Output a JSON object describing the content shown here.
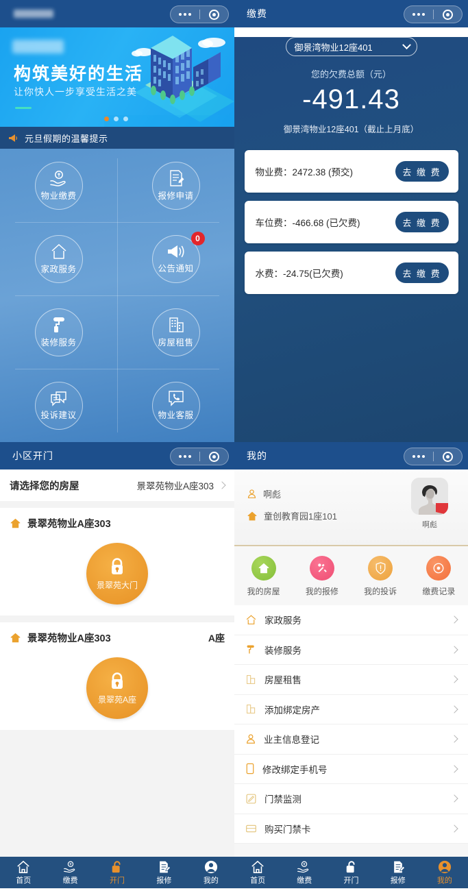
{
  "panel_home": {
    "titlebar": {
      "title": "",
      "title_blurred": true,
      "more_icon": "more-dots-icon",
      "capsule_icon": "target-icon"
    },
    "banner": {
      "badge_blurred": true,
      "headline": "构筑美好的生活",
      "subhead": "让你快人一步享受生活之美",
      "art_icon": "isometric-building-illustration",
      "dots_count": 3,
      "dot_active_index": 0,
      "dot_active_color": "#e8882c"
    },
    "notice": {
      "icon": "megaphone-icon",
      "text": "元旦假期的温馨提示"
    },
    "grid": [
      {
        "label": "物业缴费",
        "icon": "hand-coin-icon",
        "badge": null
      },
      {
        "label": "报修申请",
        "icon": "document-edit-icon",
        "badge": null
      },
      {
        "label": "家政服务",
        "icon": "home-icon",
        "badge": null
      },
      {
        "label": "公告通知",
        "icon": "speaker-icon",
        "badge": "0"
      },
      {
        "label": "装修服务",
        "icon": "paint-roller-icon",
        "badge": null
      },
      {
        "label": "房屋租售",
        "icon": "buildings-icon",
        "badge": null
      },
      {
        "label": "投诉建议",
        "icon": "chat-bubbles-icon",
        "badge": null
      },
      {
        "label": "物业客服",
        "icon": "phone-bubble-icon",
        "badge": null
      }
    ],
    "tabbar": [
      {
        "label": "首页",
        "icon": "home-icon",
        "active": true
      },
      {
        "label": "缴费",
        "icon": "hand-coin-icon",
        "active": false
      },
      {
        "label": "开门",
        "icon": "unlock-icon",
        "active": false
      },
      {
        "label": "报修",
        "icon": "document-edit-icon",
        "active": false
      },
      {
        "label": "我的",
        "icon": "user-icon",
        "active": false
      }
    ]
  },
  "panel_payment": {
    "titlebar": {
      "title": "缴费",
      "more_icon": "more-dots-icon",
      "capsule_icon": "target-icon"
    },
    "property_select": {
      "value": "御景湾物业12座401",
      "icon": "chevron-down-icon"
    },
    "owed_label": "您的欠费总额（元）",
    "owed_amount": "-491.43",
    "owed_sub": "御景湾物业12座401（截止上月底）",
    "fees": [
      {
        "text": "物业费：2472.38 (预交)",
        "button": "去 缴 费"
      },
      {
        "text": "车位费：-466.68 (已欠费)",
        "button": "去 缴 费"
      },
      {
        "text": "水费：-24.75(已欠费)",
        "button": "去 缴 费"
      }
    ],
    "tabbar": [
      {
        "label": "首页",
        "icon": "home-icon",
        "active": false
      },
      {
        "label": "缴费",
        "icon": "hand-coin-icon",
        "active": true
      },
      {
        "label": "开门",
        "icon": "unlock-icon",
        "active": false
      },
      {
        "label": "报修",
        "icon": "document-edit-icon",
        "active": false
      },
      {
        "label": "我的",
        "icon": "user-icon",
        "active": false
      }
    ]
  },
  "panel_door": {
    "titlebar": {
      "title": "小区开门",
      "more_icon": "more-dots-icon",
      "capsule_icon": "target-icon"
    },
    "select_row": {
      "label": "请选择您的房屋",
      "value": "景翠苑物业A座303",
      "icon": "chevron-right-icon"
    },
    "cards": [
      {
        "house_icon": "home-icon",
        "name": "景翠苑物业A座303",
        "right_tag": "",
        "button_label": "景翠苑大门",
        "button_icon": "lock-icon"
      },
      {
        "house_icon": "home-icon",
        "name": "景翠苑物业A座303",
        "right_tag": "A座",
        "button_label": "景翠苑A座",
        "button_icon": "lock-icon"
      }
    ],
    "tabbar": [
      {
        "label": "首页",
        "icon": "home-icon",
        "active": false
      },
      {
        "label": "缴费",
        "icon": "hand-coin-icon",
        "active": false
      },
      {
        "label": "开门",
        "icon": "unlock-icon",
        "active": true
      },
      {
        "label": "报修",
        "icon": "document-edit-icon",
        "active": false
      },
      {
        "label": "我的",
        "icon": "user-icon",
        "active": false
      }
    ]
  },
  "panel_mine": {
    "titlebar": {
      "title": "我的",
      "more_icon": "more-dots-icon",
      "capsule_icon": "target-icon"
    },
    "profile": {
      "user_icon": "user-outline-icon",
      "user_name": "啊彪",
      "home_icon": "home-icon",
      "address": "童创教育园1座101",
      "avatar_icon": "avatar-photo",
      "avatar_name": "啊彪"
    },
    "quick": [
      {
        "label": "我的房屋",
        "icon": "home-icon",
        "color": "#8cc63f"
      },
      {
        "label": "我的报修",
        "icon": "wrench-icon",
        "color": "#f0557a"
      },
      {
        "label": "我的投诉",
        "icon": "shield-icon",
        "color": "#f0a840"
      },
      {
        "label": "缴费记录",
        "icon": "coin-icon",
        "color": "#f4793f"
      }
    ],
    "menu": [
      {
        "label": "家政服务",
        "icon": "home-icon",
        "chevron": "chevron-right-icon"
      },
      {
        "label": "装修服务",
        "icon": "paint-roller-icon",
        "chevron": "chevron-right-icon"
      },
      {
        "label": "房屋租售",
        "icon": "buildings-icon",
        "chevron": "chevron-right-icon"
      },
      {
        "label": "添加绑定房产",
        "icon": "buildings-icon",
        "chevron": "chevron-right-icon"
      },
      {
        "label": "业主信息登记",
        "icon": "user-outline-icon",
        "chevron": "chevron-right-icon"
      },
      {
        "label": "修改绑定手机号",
        "icon": "phone-icon",
        "chevron": "chevron-right-icon"
      },
      {
        "label": "门禁监测",
        "icon": "edit-square-icon",
        "chevron": "chevron-right-icon"
      },
      {
        "label": "购买门禁卡",
        "icon": "card-icon",
        "chevron": "chevron-right-icon"
      }
    ],
    "tabbar": [
      {
        "label": "首页",
        "icon": "home-icon",
        "active": false
      },
      {
        "label": "缴费",
        "icon": "hand-coin-icon",
        "active": false
      },
      {
        "label": "开门",
        "icon": "unlock-icon",
        "active": false
      },
      {
        "label": "报修",
        "icon": "document-edit-icon",
        "active": false
      },
      {
        "label": "我的",
        "icon": "user-icon",
        "active": true
      }
    ]
  },
  "colors": {
    "nav_blue": "#24507f",
    "deep_blue": "#1f4a80",
    "accent_orange": "#e8912d",
    "badge_red": "#e3262b",
    "banner_cyan": "#1aa3f0"
  }
}
